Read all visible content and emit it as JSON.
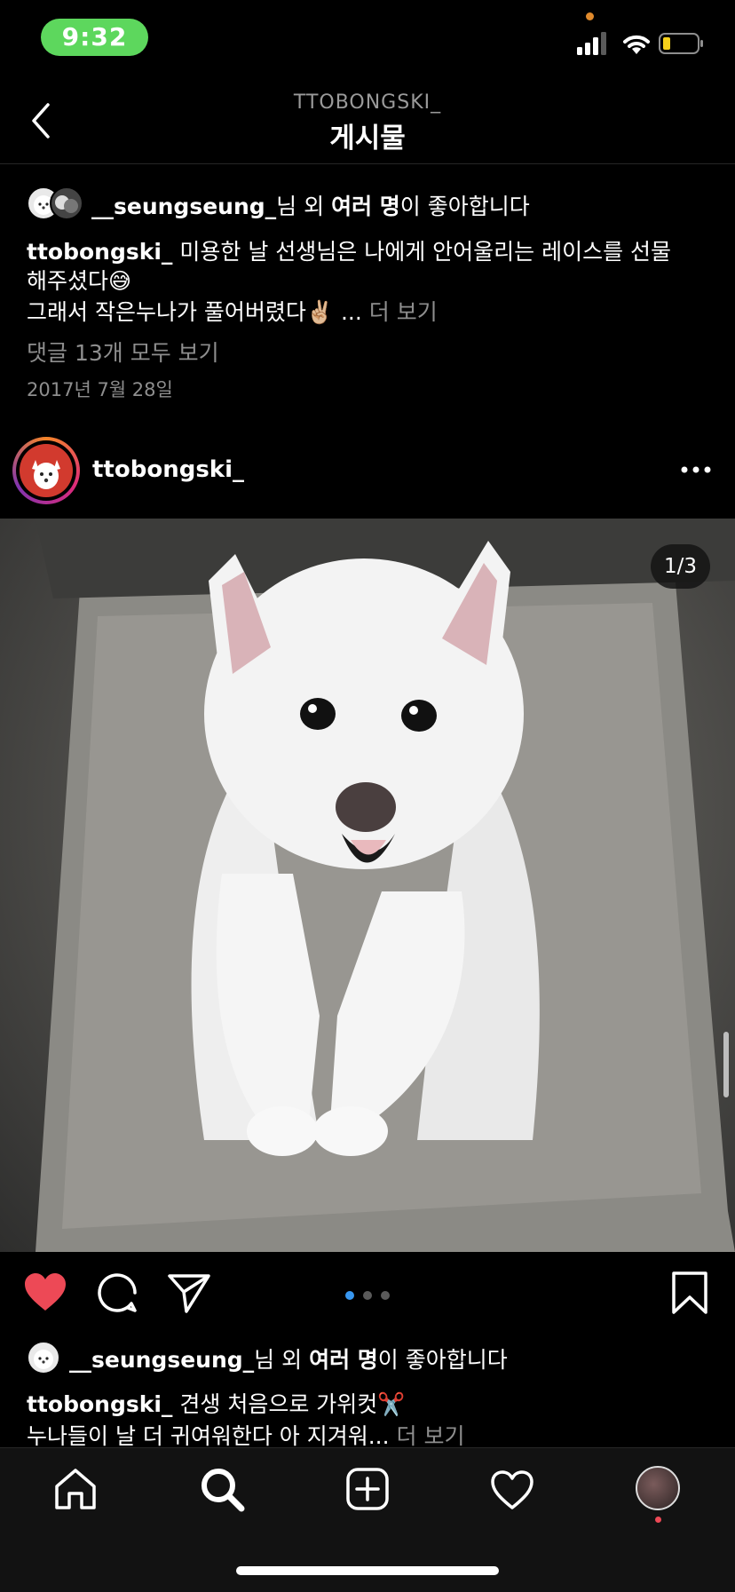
{
  "status_bar": {
    "time": "9:32"
  },
  "header": {
    "account": "TTOBONGSKI_",
    "title": "게시물"
  },
  "previous_post": {
    "likes": {
      "user": "__seungseung_",
      "suffix_1": "님 외 ",
      "bold_part": "여러 명",
      "suffix_2": "이 좋아합니다"
    },
    "caption": {
      "username": "ttobongski_",
      "line1": "미용한 날 선생님은 나에게 안어울리는 레이스를 선물",
      "line2": "해주셨다😅",
      "line3": "그래서 작은누나가 풀어버렸다✌🏼 ...",
      "more": "더 보기"
    },
    "comments_link": "댓글 13개 모두 보기",
    "date": "2017년 7월 28일"
  },
  "post": {
    "username": "ttobongski_",
    "image_counter": "1/3",
    "carousel": {
      "total": 3,
      "active": 1,
      "active_color": "#3897f0"
    },
    "likes": {
      "user": "__seungseung_",
      "suffix_1": "님 외 ",
      "bold_part": "여러 명",
      "suffix_2": "이 좋아합니다"
    },
    "caption": {
      "username": "ttobongski_",
      "line1": "견생 처음으로 가위컷✂️",
      "line2": "누나들이 날 더 귀여워한다 아 지겨워...",
      "more": "더 보기"
    }
  },
  "colors": {
    "like_red": "#ed4956",
    "status_green": "#5dd75d",
    "muted": "#8e8e8e"
  },
  "tabbar": {
    "items": [
      "home-icon",
      "search-icon",
      "add-post-icon",
      "activity-heart-icon",
      "profile-avatar"
    ]
  }
}
